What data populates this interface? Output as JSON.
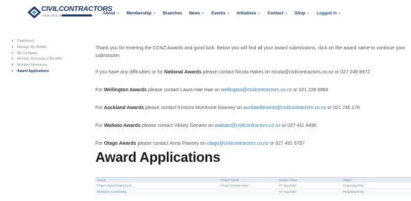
{
  "header": {
    "logo_text": "CIVILCONTRACTORS",
    "logo_sub": "NEW ZEALAND",
    "nav": [
      {
        "label": "About",
        "dropdown": true
      },
      {
        "label": "Membership",
        "dropdown": true
      },
      {
        "label": "Branches",
        "dropdown": false
      },
      {
        "label": "News",
        "dropdown": true
      },
      {
        "label": "Events",
        "dropdown": true
      },
      {
        "label": "Initiatives",
        "dropdown": true
      },
      {
        "label": "Contact",
        "dropdown": true
      },
      {
        "label": "Shop",
        "dropdown": true
      },
      {
        "label": "Logged In",
        "dropdown": true
      }
    ]
  },
  "sidebar": {
    "items": [
      {
        "label": "Dashboard"
      },
      {
        "label": "Manage My Details"
      },
      {
        "label": "My Company"
      },
      {
        "label": "Member Discounts & Benefits"
      },
      {
        "label": "Member Resources"
      },
      {
        "label": "Award Applications"
      }
    ]
  },
  "content": {
    "intro": "Thank you for entering the CCNZ Awards and good luck.  Below you will find all your award submissions, click on the award name to continue your submission.",
    "national_pre": "If you have any difficulties or for ",
    "national_bold": "National Awards",
    "national_post": " please contact Nicola Hakes on nicola@civilcontractors.co.nz or 027 248 8972.",
    "wellington_pre": "For ",
    "wellington_bold": "Wellington Awards",
    "wellington_mid": " please contact Laura Hae Hae on ",
    "wellington_email": "wellington@civilcontractors.co.nz",
    "wellington_post": " or 021 228 8984",
    "auckland_pre": "For ",
    "auckland_bold": "Auckland Awards",
    "auckland_mid": " please contact Kimiora McKenzie-Downey on ",
    "auckland_email": "aucklandevents@civilcontractors.co.nz",
    "auckland_post": " or 021 745 176",
    "waikato_pre": "For ",
    "waikato_bold": "Waikato Awards",
    "waikato_mid": " please contact Vikkey Gonano on ",
    "waikato_email": "waikato@civilcontractors.co.nz",
    "waikato_post": " or 027 411 6496",
    "otago_pre": "For ",
    "otago_bold": "Otago Awards",
    "otago_mid": " please contact Anna Pawsey on ",
    "otago_email": "otago@civilcontractors.co.nz",
    "otago_post": " or 027 491 6797",
    "heading": "Award Applications"
  },
  "table": {
    "headers": [
      "Award",
      "Project Name",
      "Entries Close",
      "Status"
    ],
    "rows": [
      [
        "Project Award Category B",
        "Project B Name here",
        "07 Aug 2020",
        "Preparing Entry"
      ],
      [
        "Woman in Contracting",
        "",
        "07 Aug 2020",
        "Preparing Entry"
      ]
    ]
  }
}
